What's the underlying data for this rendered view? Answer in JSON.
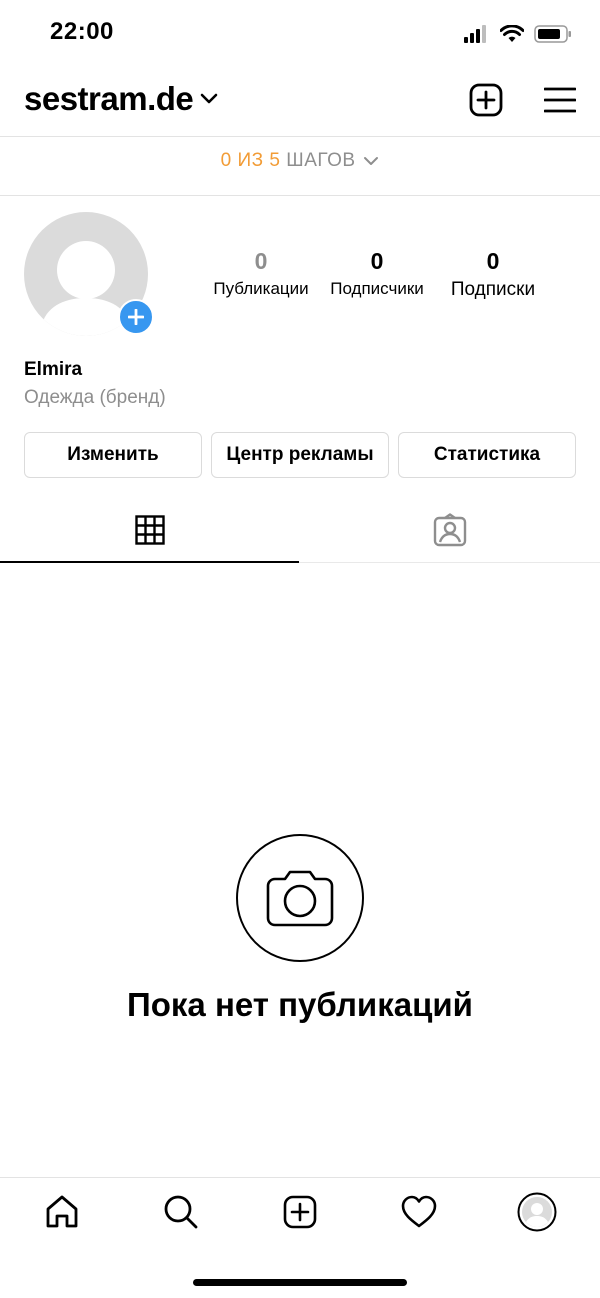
{
  "status_bar": {
    "time": "22:00"
  },
  "header": {
    "username": "sestram.de"
  },
  "steps": {
    "done": "0 ИЗ 5",
    "label": "ШАГОВ"
  },
  "profile": {
    "posts": {
      "count": "0",
      "label": "Публикации"
    },
    "followers": {
      "count": "0",
      "label": "Подписчики"
    },
    "following": {
      "count": "0",
      "label": "Подписки"
    },
    "name": "Elmira",
    "category": "Одежда (бренд)"
  },
  "buttons": {
    "edit": "Изменить",
    "ad_center": "Центр рекламы",
    "insights": "Статистика"
  },
  "empty_state": {
    "title": "Пока нет публикаций"
  },
  "colors": {
    "accent": "#f29c36",
    "badge": "#3797f0",
    "muted": "#8e8e8e",
    "border": "#dbdbdb"
  },
  "icons": {
    "header": [
      "new-post-icon",
      "menu-icon"
    ],
    "tabs": [
      "grid-icon",
      "tagged-icon"
    ],
    "nav": [
      "home-icon",
      "search-icon",
      "create-icon",
      "activity-icon",
      "profile-icon"
    ]
  }
}
